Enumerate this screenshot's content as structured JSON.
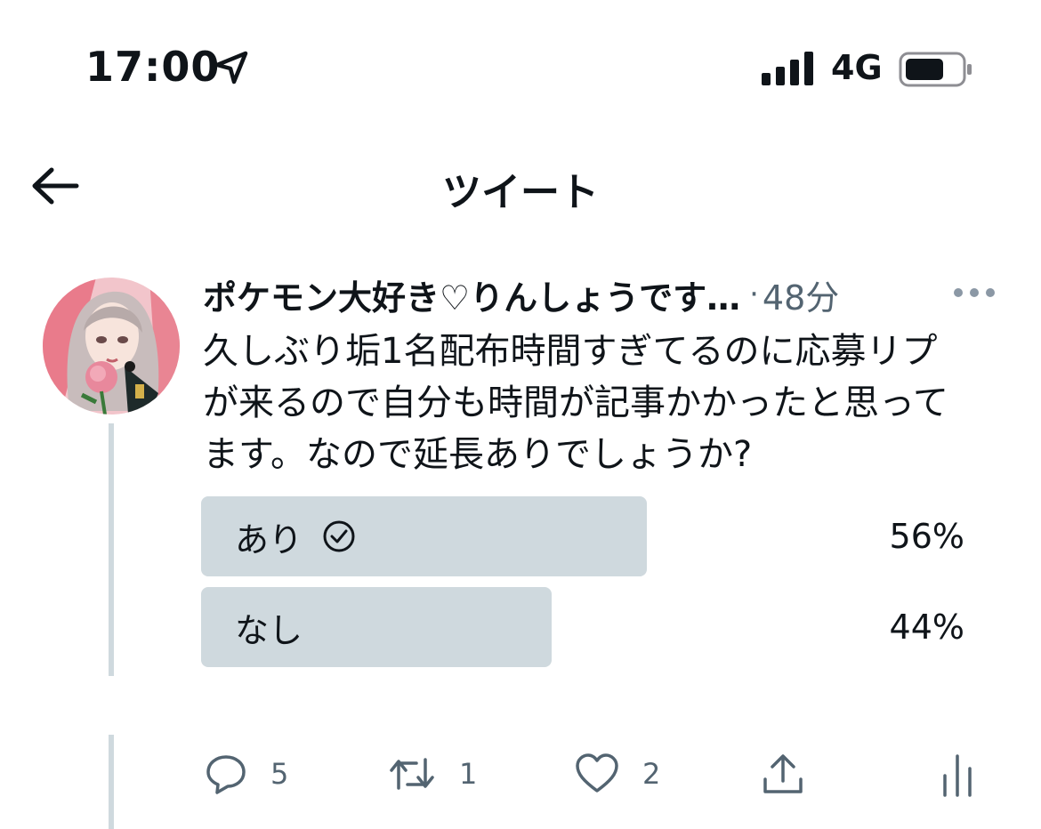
{
  "status_bar": {
    "time": "17:00",
    "network": "4G"
  },
  "header": {
    "title": "ツイート"
  },
  "tweet": {
    "user_name": "ポケモン大好き♡りんしょうです…",
    "separator": "·",
    "time_ago": "48分",
    "text": "久しぶり垢1名配布時間すぎてるのに応募リプ\nが来るので自分も時間が記事かかったと思って\nます。なので延長ありでしょうか?"
  },
  "poll": {
    "options": [
      {
        "label": "あり",
        "percent_text": "56%",
        "share": 0.56,
        "selected": true
      },
      {
        "label": "なし",
        "percent_text": "44%",
        "share": 0.44,
        "selected": false
      }
    ]
  },
  "actions": {
    "reply_count": "5",
    "retweet_count": "1",
    "like_count": "2"
  },
  "icons": [
    "location-arrow-icon",
    "signal-icon",
    "battery-icon",
    "back-arrow-icon",
    "more-icon",
    "check-circle-icon",
    "reply-icon",
    "retweet-icon",
    "like-icon",
    "share-icon",
    "analytics-icon"
  ],
  "colors": {
    "poll_bar": "#cfd9de",
    "secondary_text": "#536471",
    "primary_text": "#0f1419"
  }
}
